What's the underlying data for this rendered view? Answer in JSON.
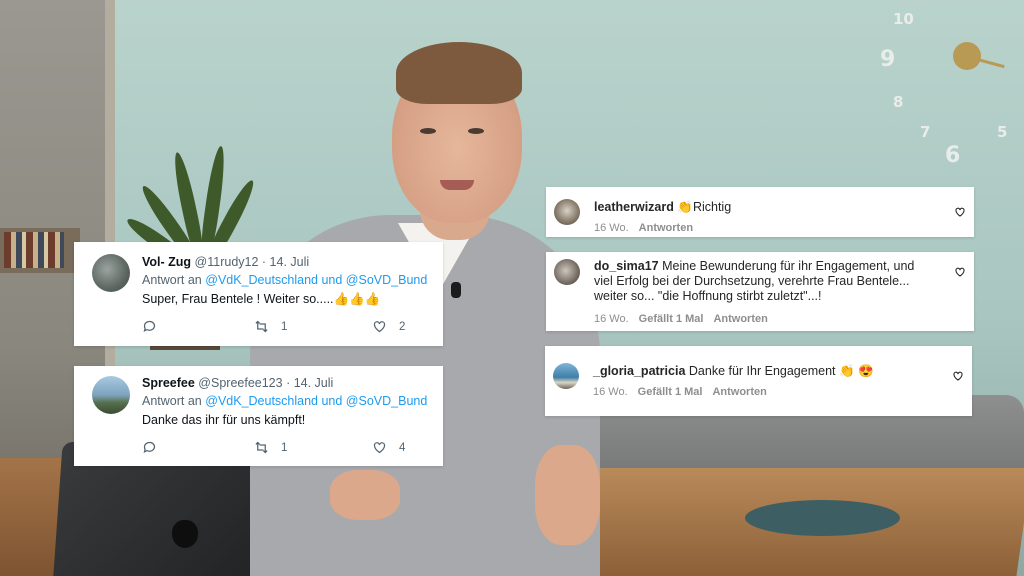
{
  "tweets": [
    {
      "name": "Vol- Zug",
      "handle": "@11rudy12",
      "date": "· 14. Juli",
      "reply_prefix": "Antwort an",
      "reply_mentions": "@VdK_Deutschland und @SoVD_Bund",
      "text": "Super, Frau Bentele ! Weiter so.....",
      "emoji": "👍👍👍",
      "retweets": "1",
      "likes": "2"
    },
    {
      "name": "Spreefee",
      "handle": "@Spreefee123",
      "date": "· 14. Juli",
      "reply_prefix": "Antwort an",
      "reply_mentions": "@VdK_Deutschland und @SoVD_Bund",
      "text": "Danke das ihr für uns kämpft!",
      "emoji": "",
      "retweets": "1",
      "likes": "4"
    }
  ],
  "instagram_comments": [
    {
      "username": "leatherwizard",
      "text": "👏Richtig",
      "age": "16 Wo.",
      "likes_label": "",
      "reply_label": "Antworten"
    },
    {
      "username": "do_sima17",
      "text_line1": "Meine Bewunderung für ihr Engagement, und",
      "text_line2": "viel Erfolg bei der Durchsetzung, verehrte Frau Bentele...",
      "text_line3": "weiter so... \"die Hoffnung stirbt zuletzt\"...!",
      "age": "16 Wo.",
      "likes_label": "Gefällt 1 Mal",
      "reply_label": "Antworten"
    },
    {
      "username": "_gloria_patricia",
      "text": "Danke für Ihr Engagement 👏 😍",
      "age": "16 Wo.",
      "likes_label": "Gefällt 1 Mal",
      "reply_label": "Antworten"
    }
  ],
  "background": {
    "clock_numbers": [
      "10",
      "9",
      "8",
      "7",
      "5",
      "6"
    ]
  },
  "colors": {
    "twitter_link": "#1d9bf0",
    "twitter_gray": "#536471",
    "instagram_gray": "#8e8e8e"
  }
}
